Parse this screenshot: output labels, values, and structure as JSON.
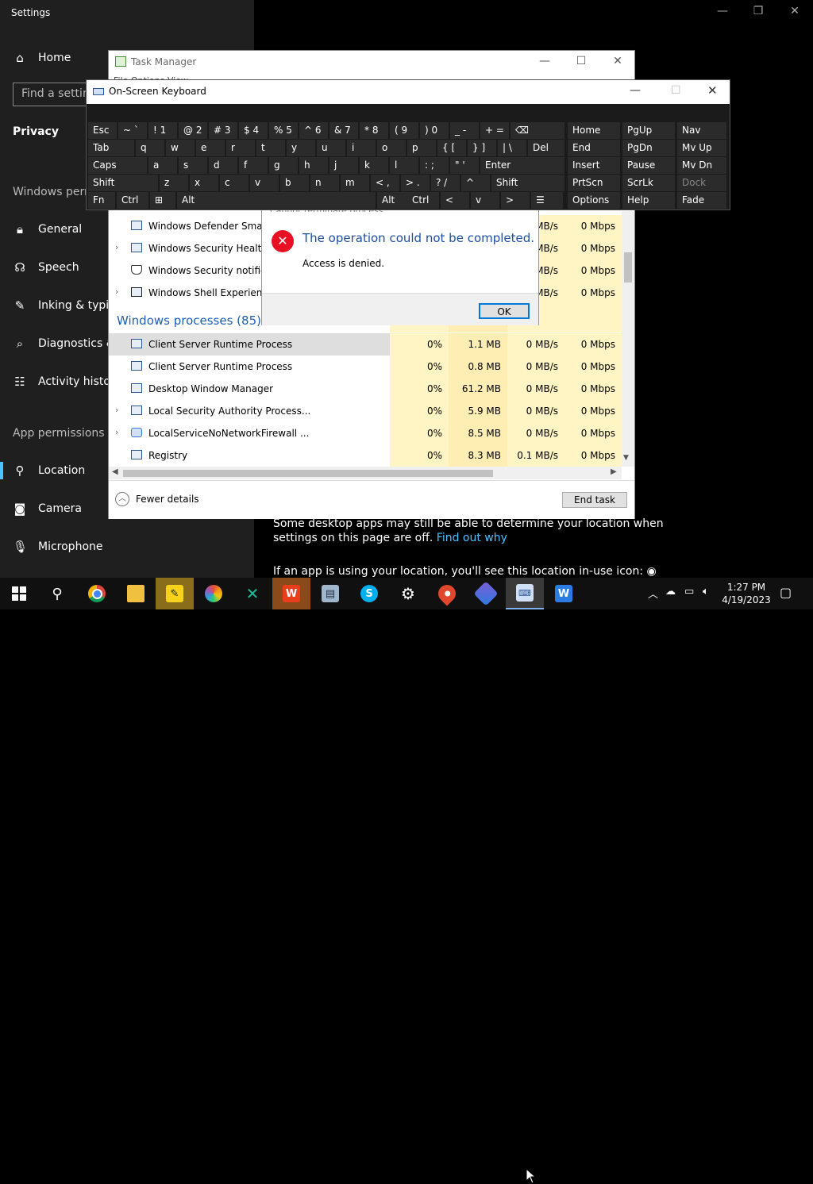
{
  "settings": {
    "title": "Settings",
    "home": "Home",
    "search_placeholder": "Find a setting",
    "privacy": "Privacy",
    "windows_permissions_header": "Windows perm",
    "windows_items": [
      "General",
      "Speech",
      "Inking & typing",
      "Diagnostics &",
      "Activity history"
    ],
    "app_permissions_header": "App permissions",
    "app_items": [
      "Location",
      "Camera",
      "Microphone"
    ],
    "body_line1": "Some desktop apps may still be able to determine your location when",
    "body_line2": "settings on this page are off.",
    "find_out_why": "Find out why",
    "body_line3": "If an app is using your location, you'll see this location in-use icon:"
  },
  "task_manager": {
    "title": "Task Manager",
    "menu_fragment": "File  Options  View",
    "top_rows": [
      {
        "name": "Windows Defender SmartSc",
        "net1": "MB/s",
        "net2": "0 Mbps",
        "expand": false
      },
      {
        "name": "Windows Security Health S",
        "net1": "MB/s",
        "net2": "0 Mbps",
        "expand": true
      },
      {
        "name": "Windows Security notificat",
        "net1": "MB/s",
        "net2": "0 Mbps",
        "expand": false
      },
      {
        "name": "Windows Shell Experience I",
        "net1": "MB/s",
        "net2": "0 Mbps",
        "expand": true
      }
    ],
    "group_label": "Windows processes (85)",
    "rows": [
      {
        "name": "Client Server Runtime Process",
        "cpu": "0%",
        "mem": "1.1 MB",
        "disk": "0 MB/s",
        "net": "0 Mbps",
        "expand": false
      },
      {
        "name": "Client Server Runtime Process",
        "cpu": "0%",
        "mem": "0.8 MB",
        "disk": "0 MB/s",
        "net": "0 Mbps",
        "expand": false
      },
      {
        "name": "Desktop Window Manager",
        "cpu": "0%",
        "mem": "61.2 MB",
        "disk": "0 MB/s",
        "net": "0 Mbps",
        "expand": false
      },
      {
        "name": "Local Security Authority Process...",
        "cpu": "0%",
        "mem": "5.9 MB",
        "disk": "0 MB/s",
        "net": "0 Mbps",
        "expand": true
      },
      {
        "name": "LocalServiceNoNetworkFirewall ...",
        "cpu": "0%",
        "mem": "8.5 MB",
        "disk": "0 MB/s",
        "net": "0 Mbps",
        "expand": true
      },
      {
        "name": "Registry",
        "cpu": "0%",
        "mem": "8.3 MB",
        "disk": "0.1 MB/s",
        "net": "0 Mbps",
        "expand": false
      }
    ],
    "fewer_details": "Fewer details",
    "end_task": "End task"
  },
  "dialog": {
    "title_fragment": "Cannot terminate process",
    "message": "The operation could not be completed.",
    "detail": "Access is denied.",
    "ok": "OK"
  },
  "osk": {
    "title": "On-Screen Keyboard",
    "rows": [
      [
        "Esc",
        "~ `",
        "! 1",
        "@ 2",
        "# 3",
        "$ 4",
        "% 5",
        "^ 6",
        "& 7",
        "* 8",
        "( 9",
        ") 0",
        "_ -",
        "+ =",
        "⌫"
      ],
      [
        "Tab",
        "q",
        "w",
        "e",
        "r",
        "t",
        "y",
        "u",
        "i",
        "o",
        "p",
        "{ [",
        "} ]",
        "| \\",
        "Del"
      ],
      [
        "Caps",
        "a",
        "s",
        "d",
        "f",
        "g",
        "h",
        "j",
        "k",
        "l",
        ": ;",
        "\" '",
        "Enter"
      ],
      [
        "Shift",
        "z",
        "x",
        "c",
        "v",
        "b",
        "n",
        "m",
        "< ,",
        "> .",
        "? /",
        "^",
        "Shift"
      ],
      [
        "Fn",
        "Ctrl",
        "⊞",
        "Alt",
        "Alt",
        "Ctrl",
        "<",
        "v",
        ">",
        "☰"
      ]
    ],
    "nav_rows": [
      [
        "Home",
        "PgUp",
        "Nav"
      ],
      [
        "End",
        "PgDn",
        "Mv Up"
      ],
      [
        "Insert",
        "Pause",
        "Mv Dn"
      ],
      [
        "PrtScn",
        "ScrLk",
        "Dock"
      ],
      [
        "Options",
        "Help",
        "Fade"
      ]
    ]
  },
  "taskbar": {
    "time": "1:27 PM",
    "date": "4/19/2023",
    "apps": [
      "start-icon",
      "search-icon",
      "chrome-icon",
      "file-explorer-icon",
      "sticky-notes-icon",
      "photos-icon",
      "xmind-icon",
      "office-icon",
      "control-panel-icon",
      "skype-icon",
      "settings-icon",
      "maps-icon",
      "power-automate-icon",
      "osk-icon",
      "wps-icon"
    ]
  }
}
